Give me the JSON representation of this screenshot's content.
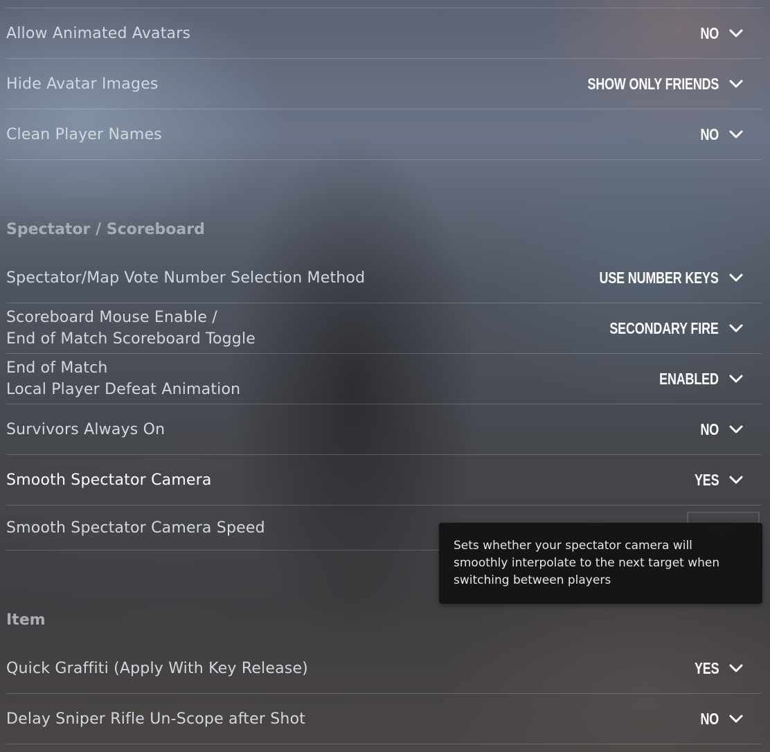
{
  "settings_top": [
    {
      "label": "Allow Animated Avatars",
      "value": "NO"
    },
    {
      "label": "Hide Avatar Images",
      "value": "SHOW ONLY FRIENDS"
    },
    {
      "label": "Clean Player Names",
      "value": "NO"
    }
  ],
  "spectator_section": {
    "title": "Spectator / Scoreboard",
    "rows": [
      {
        "label": "Spectator/Map Vote Number Selection Method",
        "value": "USE NUMBER KEYS"
      },
      {
        "label_line1": "Scoreboard Mouse Enable /",
        "label_line2": "End of Match Scoreboard Toggle",
        "value": "SECONDARY FIRE"
      },
      {
        "label_line1": "End of Match",
        "label_line2": "Local Player Defeat Animation",
        "value": "ENABLED"
      },
      {
        "label": "Survivors Always On",
        "value": "NO"
      },
      {
        "label": "Smooth Spectator Camera",
        "value": "YES"
      }
    ],
    "camera_speed": {
      "label": "Smooth Spectator Camera Speed",
      "value": "0.27"
    }
  },
  "tooltip": {
    "text_line1": "Sets whether your spectator camera will",
    "text_line2": "smoothly interpolate to the next target when",
    "text_line3": "switching between players"
  },
  "item_section": {
    "title": "Item",
    "rows": [
      {
        "label": "Quick Graffiti (Apply With Key Release)",
        "value": "YES"
      },
      {
        "label": "Delay Sniper Rifle Un-Scope after Shot",
        "value": "NO"
      }
    ]
  },
  "icons": {
    "dropdown": "chevron-down-icon"
  },
  "colors": {
    "tooltip_bg": "#141414",
    "value_text": "#ffffff",
    "section_title": "#a9aeb4"
  }
}
